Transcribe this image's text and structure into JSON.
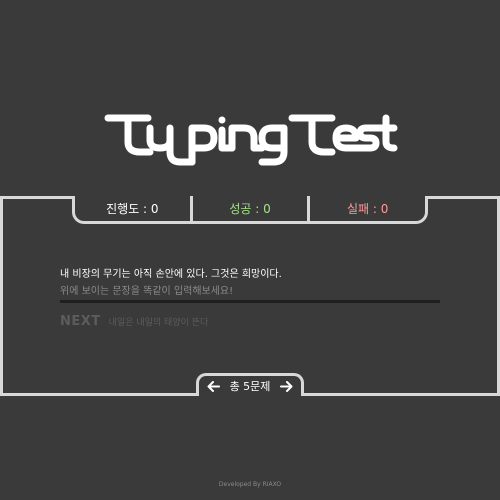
{
  "app": {
    "title": "TypingTest"
  },
  "stats": {
    "progress": "진행도 : 0",
    "success": "성공 : 0",
    "fail": "실패 : 0"
  },
  "quiz": {
    "sentence": "내 비장의 무기는 아직 손안에 있다. 그것은 희망이다.",
    "input_value": "",
    "input_placeholder": "위에 보이는 문장을 똑같이 입력해보세요!",
    "next_label": "NEXT",
    "next_sentence": "내일은 내일의 태양이 뜬다"
  },
  "pager": {
    "count": "총 5문제",
    "prev_icon": "arrow-left-icon",
    "next_icon": "arrow-right-icon"
  },
  "footer": {
    "text": "Developed By RIAXO"
  },
  "colors": {
    "background": "#3a3a3a",
    "border": "#d8d8d8",
    "success": "#a6e08a",
    "fail": "#ff9a9a",
    "muted": "#5c5c5c"
  }
}
